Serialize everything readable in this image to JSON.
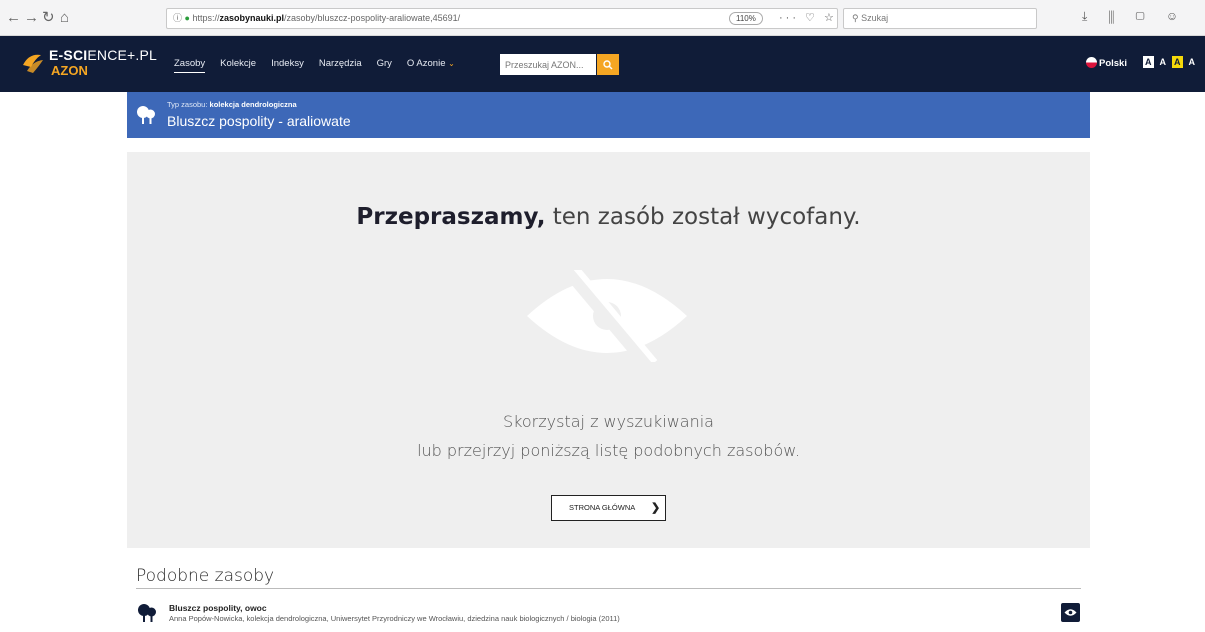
{
  "browser": {
    "back": "←",
    "forward": "→",
    "reload": "↻",
    "home": "⌂",
    "url_prefix": "https://",
    "url_host": "zasobynauki.pl",
    "url_path": "/zasoby/bluszcz-pospolity-araliowate,45691/",
    "zoom": "110%",
    "page_actions": "··· ♡ ☆",
    "search_placeholder": "Szukaj",
    "toolbar_icons": "⤓ ⫼ ▢ ☺"
  },
  "site": {
    "logo_main_bold": "E-SCI",
    "logo_main_light": "ENCE+.PL",
    "logo_sub": "AZON",
    "nav": [
      {
        "label": "Zasoby"
      },
      {
        "label": "Kolekcje"
      },
      {
        "label": "Indeksy"
      },
      {
        "label": "Narzędzia"
      },
      {
        "label": "Gry"
      },
      {
        "label": "O Azonie"
      }
    ],
    "search_placeholder": "Przeszukaj AZON...",
    "language": "Polski",
    "font_sizes": [
      "A",
      "A",
      "A",
      "A"
    ]
  },
  "resource": {
    "type_label": "Typ zasobu:",
    "type_value": "kolekcja dendrologiczna",
    "title": "Bluszcz pospolity - araliowate"
  },
  "withdrawn": {
    "headline_bold": "Przepraszamy,",
    "headline_rest": "ten zasób został wycofany.",
    "hint_line1": "Skorzystaj z wyszukiwania",
    "hint_line2": "lub przejrzyj poniższą listę podobnych zasobów.",
    "home_button": "STRONA GŁÓWNA"
  },
  "similar": {
    "title": "Podobne zasoby",
    "items": [
      {
        "title": "Bluszcz pospolity, owoc",
        "meta": "Anna Popów-Nowicka, kolekcja dendrologiczna, Uniwersytet Przyrodniczy we Wrocławiu, dziedzina nauk biologicznych / biologia (2011)"
      }
    ]
  },
  "colors": {
    "header_bg": "#101c38",
    "accent": "#f5a623",
    "banner_bg": "#3d68b8",
    "panel_bg": "#efefef"
  }
}
